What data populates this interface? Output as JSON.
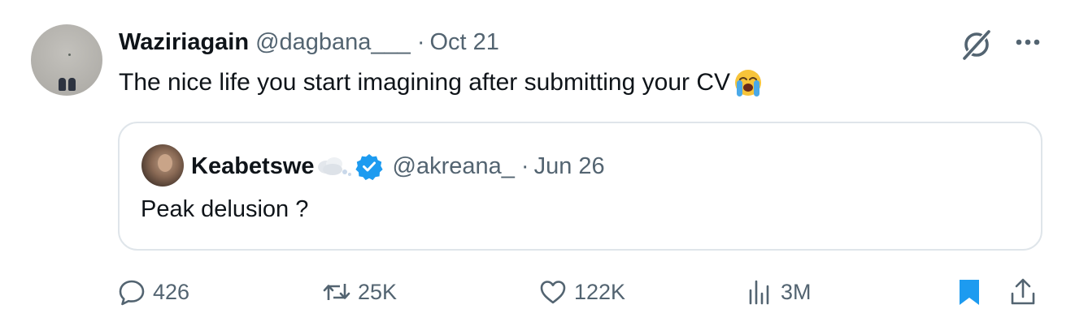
{
  "tweet": {
    "author_name": "Waziriagain",
    "author_handle": "@dagbana___",
    "separator": "·",
    "date": "Oct 21",
    "text": "The nice life you start imagining after submitting your CV",
    "text_emoji": "loudly-crying-face-emoji",
    "grok_icon": "grok-icon",
    "more_icon": "more-options-icon"
  },
  "quote": {
    "author_name": "Keabetswe",
    "author_emoji": "cloud-face-emoji",
    "verified_icon": "verified-badge-icon",
    "author_handle": "@akreana_",
    "separator": "·",
    "date": "Jun 26",
    "text": "Peak delusion ?"
  },
  "actions": {
    "reply": {
      "icon": "reply-icon",
      "count": "426"
    },
    "retweet": {
      "icon": "retweet-icon",
      "count": "25K"
    },
    "like": {
      "icon": "like-icon",
      "count": "122K"
    },
    "views": {
      "icon": "views-icon",
      "count": "3M"
    },
    "bookmark": {
      "icon": "bookmark-icon",
      "active": true
    },
    "share": {
      "icon": "share-icon"
    }
  },
  "colors": {
    "text_primary": "#0f1419",
    "text_secondary": "#536471",
    "accent_blue": "#1d9bf0",
    "border": "#dfe5ea"
  }
}
